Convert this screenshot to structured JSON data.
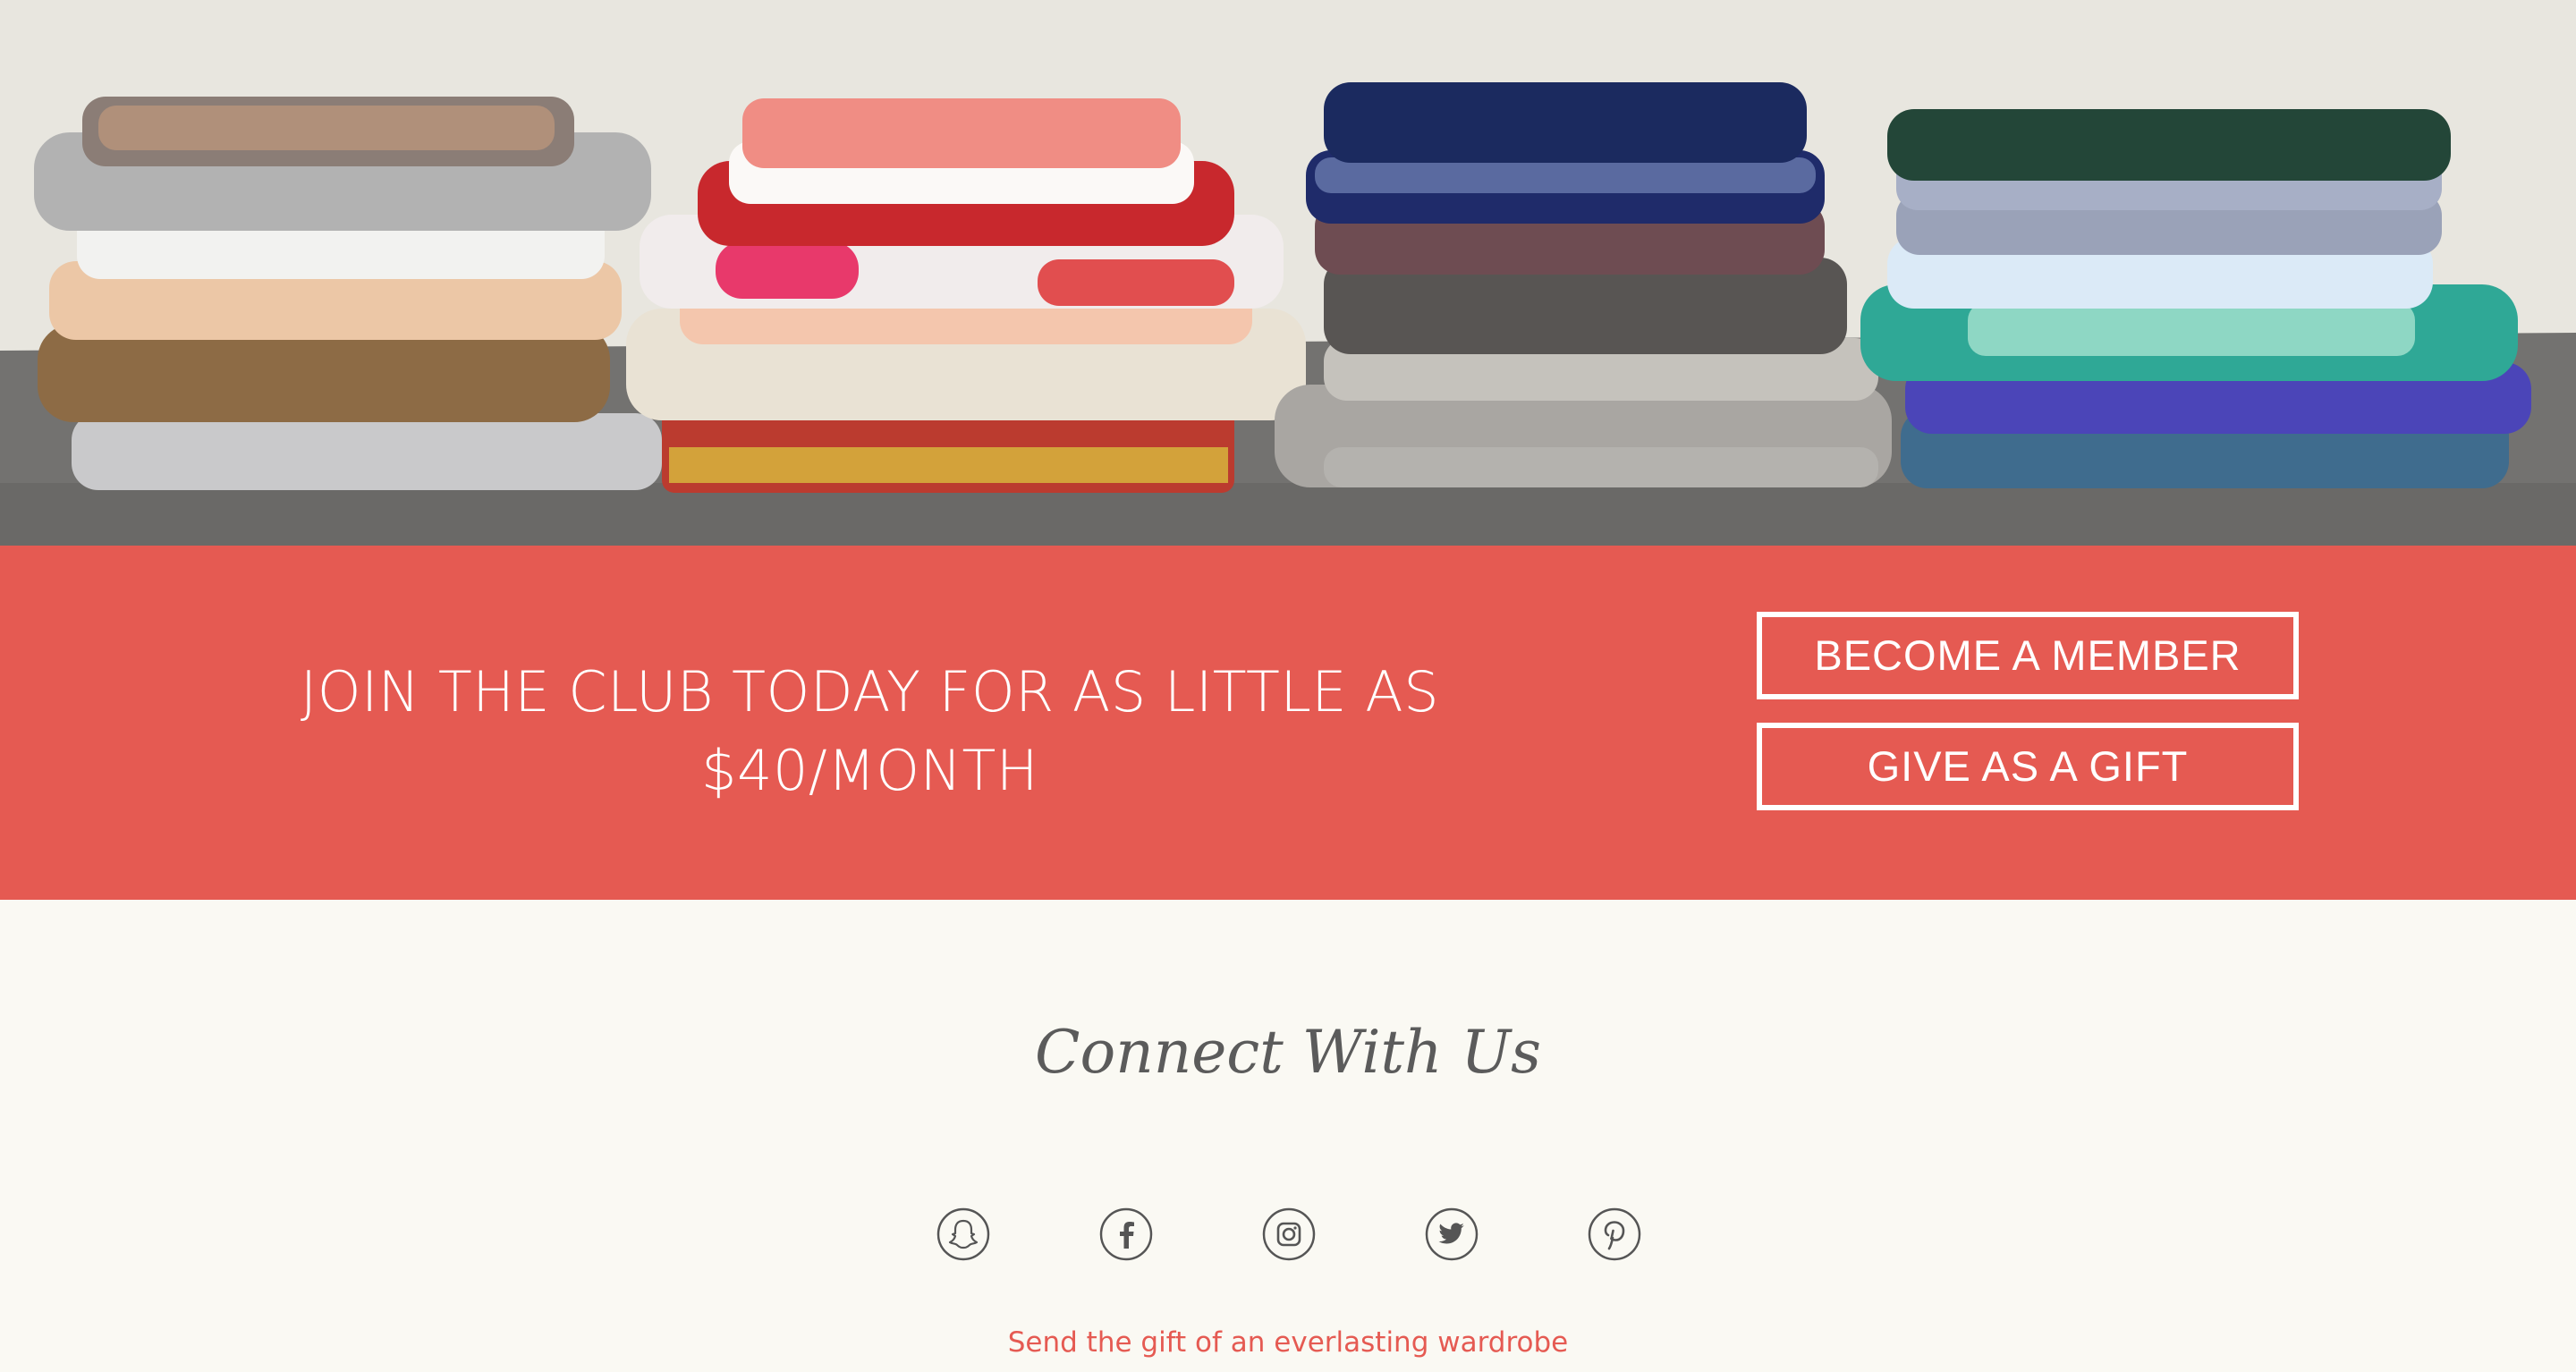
{
  "hero": {
    "image": "folded-clothes-stacks-photo"
  },
  "cta": {
    "headline_line1": "JOIN THE CLUB TODAY FOR AS LITTLE AS",
    "headline_line2": "$40/MONTH",
    "member_button": "BECOME A MEMBER",
    "gift_button": "GIVE AS A GIFT",
    "band_color": "#e55a52"
  },
  "connect": {
    "title": "Connect With Us",
    "icons": [
      "snapchat-icon",
      "facebook-icon",
      "instagram-icon",
      "twitter-icon",
      "pinterest-icon"
    ],
    "tagline": "Send the gift of an everlasting wardrobe"
  }
}
